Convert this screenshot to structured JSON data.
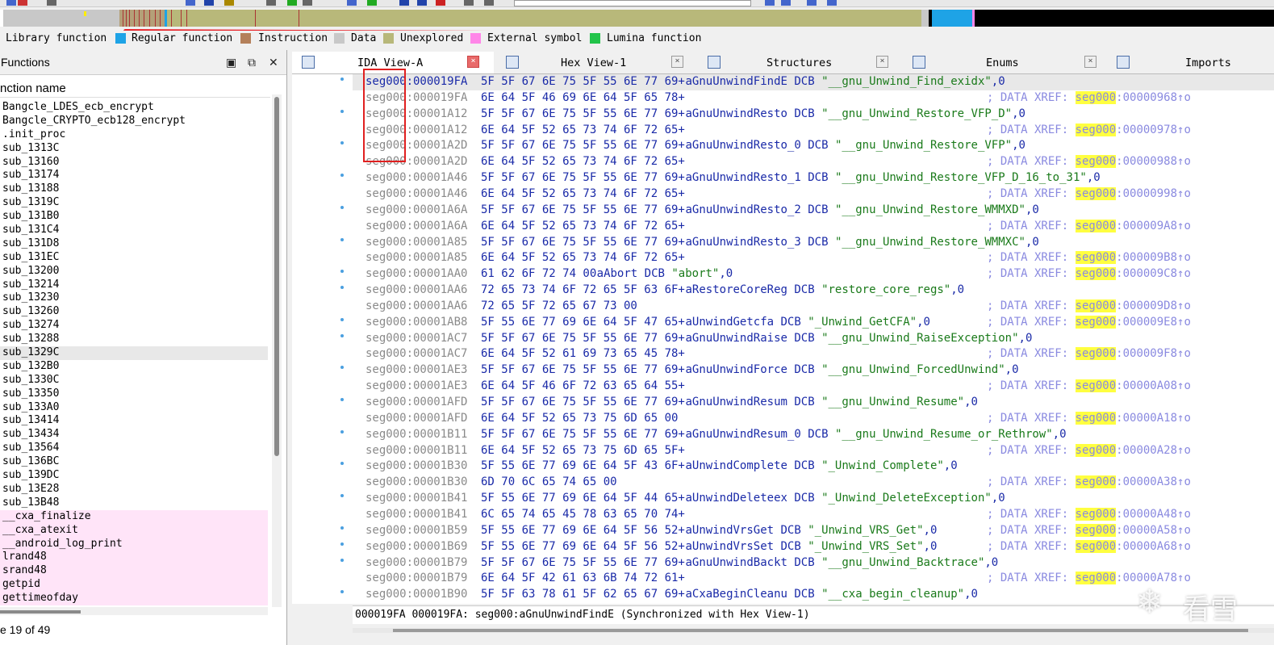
{
  "legend": [
    {
      "label": "Library function",
      "color": "#c8c8c8"
    },
    {
      "label": "Regular function",
      "color": "#1ea3e6"
    },
    {
      "label": "Instruction",
      "color": "#b4805a"
    },
    {
      "label": "Data",
      "color": "#c8c8c8"
    },
    {
      "label": "Unexplored",
      "color": "#b8b87a"
    },
    {
      "label": "External symbol",
      "color": "#ff86e8"
    },
    {
      "label": "Lumina function",
      "color": "#22c44a"
    }
  ],
  "functions_panel": {
    "title": "Functions",
    "column_header": "nction name",
    "items": [
      {
        "name": "Bangcle_LDES_ecb_encrypt",
        "lib": false
      },
      {
        "name": "Bangcle_CRYPTO_ecb128_encrypt",
        "lib": false
      },
      {
        "name": ".init_proc",
        "lib": false
      },
      {
        "name": "sub_1313C",
        "lib": false
      },
      {
        "name": "sub_13160",
        "lib": false
      },
      {
        "name": "sub_13174",
        "lib": false
      },
      {
        "name": "sub_13188",
        "lib": false
      },
      {
        "name": "sub_1319C",
        "lib": false
      },
      {
        "name": "sub_131B0",
        "lib": false
      },
      {
        "name": "sub_131C4",
        "lib": false
      },
      {
        "name": "sub_131D8",
        "lib": false
      },
      {
        "name": "sub_131EC",
        "lib": false
      },
      {
        "name": "sub_13200",
        "lib": false
      },
      {
        "name": "sub_13214",
        "lib": false
      },
      {
        "name": "sub_13230",
        "lib": false
      },
      {
        "name": "sub_13260",
        "lib": false
      },
      {
        "name": "sub_13274",
        "lib": false
      },
      {
        "name": "sub_13288",
        "lib": false
      },
      {
        "name": "sub_1329C",
        "lib": false,
        "selected": true
      },
      {
        "name": "sub_132B0",
        "lib": false
      },
      {
        "name": "sub_1330C",
        "lib": false
      },
      {
        "name": "sub_13350",
        "lib": false
      },
      {
        "name": "sub_133A0",
        "lib": false
      },
      {
        "name": "sub_13414",
        "lib": false
      },
      {
        "name": "sub_13434",
        "lib": false
      },
      {
        "name": "sub_13564",
        "lib": false
      },
      {
        "name": "sub_136BC",
        "lib": false
      },
      {
        "name": "sub_139DC",
        "lib": false
      },
      {
        "name": "sub_13E28",
        "lib": false
      },
      {
        "name": "sub_13B48",
        "lib": false
      },
      {
        "name": "__cxa_finalize",
        "lib": true
      },
      {
        "name": "__cxa_atexit",
        "lib": true
      },
      {
        "name": "__android_log_print",
        "lib": true
      },
      {
        "name": "lrand48",
        "lib": true
      },
      {
        "name": "srand48",
        "lib": true
      },
      {
        "name": "getpid",
        "lib": true
      },
      {
        "name": "gettimeofday",
        "lib": true
      }
    ],
    "status": "e 19 of 49"
  },
  "tabs": [
    {
      "label": "IDA View-A",
      "active": true
    },
    {
      "label": "Hex View-1",
      "active": false
    },
    {
      "label": "Structures",
      "active": false
    },
    {
      "label": "Enums",
      "active": false
    },
    {
      "label": "Imports",
      "active": false
    }
  ],
  "disasm": [
    {
      "addr": "seg000:000019FA",
      "bytes": "5F 5F 67 6E 75 5F 55 6E 77 69+",
      "code": "aGnuUnwindFindE DCB \"__gnu_Unwind_Find_exidx\",0",
      "xref": ""
    },
    {
      "addr": "seg000:000019FA",
      "bytes": "6E 64 5F 46 69 6E 64 5F 65 78+",
      "code": "",
      "xref": "00000968"
    },
    {
      "addr": "seg000:00001A12",
      "bytes": "5F 5F 67 6E 75 5F 55 6E 77 69+",
      "code": "aGnuUnwindResto DCB \"__gnu_Unwind_Restore_VFP_D\",0",
      "xref": ""
    },
    {
      "addr": "seg000:00001A12",
      "bytes": "6E 64 5F 52 65 73 74 6F 72 65+",
      "code": "",
      "xref": "00000978"
    },
    {
      "addr": "seg000:00001A2D",
      "bytes": "5F 5F 67 6E 75 5F 55 6E 77 69+",
      "code": "aGnuUnwindResto_0 DCB \"__gnu_Unwind_Restore_VFP\",0",
      "xref": ""
    },
    {
      "addr": "seg000:00001A2D",
      "bytes": "6E 64 5F 52 65 73 74 6F 72 65+",
      "code": "",
      "xref": "00000988"
    },
    {
      "addr": "seg000:00001A46",
      "bytes": "5F 5F 67 6E 75 5F 55 6E 77 69+",
      "code": "aGnuUnwindResto_1 DCB \"__gnu_Unwind_Restore_VFP_D_16_to_31\",0",
      "xref": ""
    },
    {
      "addr": "seg000:00001A46",
      "bytes": "6E 64 5F 52 65 73 74 6F 72 65+",
      "code": "",
      "xref": "00000998"
    },
    {
      "addr": "seg000:00001A6A",
      "bytes": "5F 5F 67 6E 75 5F 55 6E 77 69+",
      "code": "aGnuUnwindResto_2 DCB \"__gnu_Unwind_Restore_WMMXD\",0",
      "xref": ""
    },
    {
      "addr": "seg000:00001A6A",
      "bytes": "6E 64 5F 52 65 73 74 6F 72 65+",
      "code": "",
      "xref": "000009A8"
    },
    {
      "addr": "seg000:00001A85",
      "bytes": "5F 5F 67 6E 75 5F 55 6E 77 69+",
      "code": "aGnuUnwindResto_3 DCB \"__gnu_Unwind_Restore_WMMXC\",0",
      "xref": ""
    },
    {
      "addr": "seg000:00001A85",
      "bytes": "6E 64 5F 52 65 73 74 6F 72 65+",
      "code": "",
      "xref": "000009B8"
    },
    {
      "addr": "seg000:00001AA0",
      "bytes": "61 62 6F 72 74 00",
      "code": "               aAbort DCB \"abort\",0",
      "xref": "000009C8"
    },
    {
      "addr": "seg000:00001AA6",
      "bytes": "72 65 73 74 6F 72 65 5F 63 6F+",
      "code": "aRestoreCoreReg DCB \"restore_core_regs\",0",
      "xref": ""
    },
    {
      "addr": "seg000:00001AA6",
      "bytes": "72 65 5F 72 65 67 73 00",
      "code": "",
      "xref": "000009D8"
    },
    {
      "addr": "seg000:00001AB8",
      "bytes": "5F 55 6E 77 69 6E 64 5F 47 65+",
      "code": "aUnwindGetcfa DCB \"_Unwind_GetCFA\",0",
      "xref": "000009E8"
    },
    {
      "addr": "seg000:00001AC7",
      "bytes": "5F 5F 67 6E 75 5F 55 6E 77 69+",
      "code": "aGnuUnwindRaise DCB \"__gnu_Unwind_RaiseException\",0",
      "xref": ""
    },
    {
      "addr": "seg000:00001AC7",
      "bytes": "6E 64 5F 52 61 69 73 65 45 78+",
      "code": "",
      "xref": "000009F8"
    },
    {
      "addr": "seg000:00001AE3",
      "bytes": "5F 5F 67 6E 75 5F 55 6E 77 69+",
      "code": "aGnuUnwindForce DCB \"__gnu_Unwind_ForcedUnwind\",0",
      "xref": ""
    },
    {
      "addr": "seg000:00001AE3",
      "bytes": "6E 64 5F 46 6F 72 63 65 64 55+",
      "code": "",
      "xref": "00000A08"
    },
    {
      "addr": "seg000:00001AFD",
      "bytes": "5F 5F 67 6E 75 5F 55 6E 77 69+",
      "code": "aGnuUnwindResum DCB \"__gnu_Unwind_Resume\",0",
      "xref": ""
    },
    {
      "addr": "seg000:00001AFD",
      "bytes": "6E 64 5F 52 65 73 75 6D 65 00",
      "code": "",
      "xref": "00000A18"
    },
    {
      "addr": "seg000:00001B11",
      "bytes": "5F 5F 67 6E 75 5F 55 6E 77 69+",
      "code": "aGnuUnwindResum_0 DCB \"__gnu_Unwind_Resume_or_Rethrow\",0",
      "xref": ""
    },
    {
      "addr": "seg000:00001B11",
      "bytes": "6E 64 5F 52 65 73 75 6D 65 5F+",
      "code": "",
      "xref": "00000A28"
    },
    {
      "addr": "seg000:00001B30",
      "bytes": "5F 55 6E 77 69 6E 64 5F 43 6F+",
      "code": "aUnwindComplete DCB \"_Unwind_Complete\",0",
      "xref": ""
    },
    {
      "addr": "seg000:00001B30",
      "bytes": "6D 70 6C 65 74 65 00",
      "code": "",
      "xref": "00000A38"
    },
    {
      "addr": "seg000:00001B41",
      "bytes": "5F 55 6E 77 69 6E 64 5F 44 65+",
      "code": "aUnwindDeleteex DCB \"_Unwind_DeleteException\",0",
      "xref": ""
    },
    {
      "addr": "seg000:00001B41",
      "bytes": "6C 65 74 65 45 78 63 65 70 74+",
      "code": "",
      "xref": "00000A48"
    },
    {
      "addr": "seg000:00001B59",
      "bytes": "5F 55 6E 77 69 6E 64 5F 56 52+",
      "code": "aUnwindVrsGet DCB \"_Unwind_VRS_Get\",0",
      "xref": "00000A58"
    },
    {
      "addr": "seg000:00001B69",
      "bytes": "5F 55 6E 77 69 6E 64 5F 56 52+",
      "code": "aUnwindVrsSet DCB \"_Unwind_VRS_Set\",0",
      "xref": "00000A68"
    },
    {
      "addr": "seg000:00001B79",
      "bytes": "5F 5F 67 6E 75 5F 55 6E 77 69+",
      "code": "aGnuUnwindBackt DCB \"__gnu_Unwind_Backtrace\",0",
      "xref": ""
    },
    {
      "addr": "seg000:00001B79",
      "bytes": "6E 64 5F 42 61 63 6B 74 72 61+",
      "code": "",
      "xref": "00000A78"
    },
    {
      "addr": "seg000:00001B90",
      "bytes": "5F 5F 63 78 61 5F 62 65 67 69+",
      "code": "aCxaBeginCleanu DCB \"__cxa_begin_cleanup\",0",
      "xref": ""
    }
  ],
  "xref_prefix": "; DATA XREF: ",
  "xref_seg": "seg000",
  "xref_suffix": "↑o",
  "status_line": "000019FA 000019FA: seg000:aGnuUnwindFindE (Synchronized with Hex View-1)",
  "watermark": {
    "text": "看雪"
  }
}
